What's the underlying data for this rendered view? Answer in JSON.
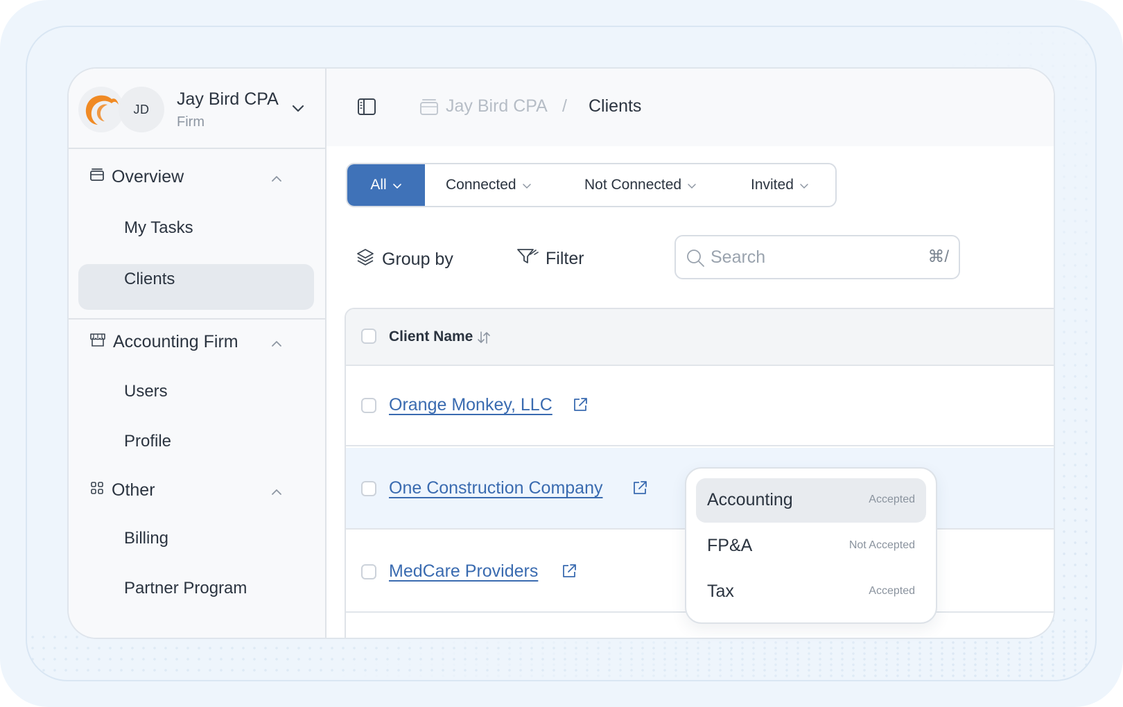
{
  "firm": {
    "initials": "JD",
    "name": "Jay Bird CPA",
    "type": "Firm"
  },
  "sidebar": {
    "sections": [
      {
        "label": "Overview",
        "items": [
          "My Tasks",
          "Clients"
        ]
      },
      {
        "label": "Accounting Firm",
        "items": [
          "Users",
          "Profile"
        ]
      },
      {
        "label": "Other",
        "items": [
          "Billing",
          "Partner Program"
        ]
      }
    ],
    "active_item": "Clients"
  },
  "breadcrumb": {
    "parent": "Jay Bird CPA",
    "separator": "/",
    "current": "Clients"
  },
  "segments": [
    "All",
    "Connected",
    "Not Connected",
    "Invited"
  ],
  "toolbar": {
    "group_by": "Group by",
    "filter": "Filter"
  },
  "search": {
    "placeholder": "Search",
    "shortcut": "⌘/"
  },
  "table": {
    "column": "Client Name",
    "rows": [
      "Orange Monkey, LLC",
      "One Construction Company",
      "MedCare Providers"
    ]
  },
  "popup": {
    "options": [
      {
        "label": "Accounting",
        "status": "Accepted"
      },
      {
        "label": "FP&A",
        "status": "Not Accepted"
      },
      {
        "label": "Tax",
        "status": "Accepted"
      }
    ]
  },
  "colors": {
    "accent": "#3f72b8",
    "link": "#3a6bb0",
    "logo": "#f08a24",
    "row_highlight": "#eef5fd"
  }
}
